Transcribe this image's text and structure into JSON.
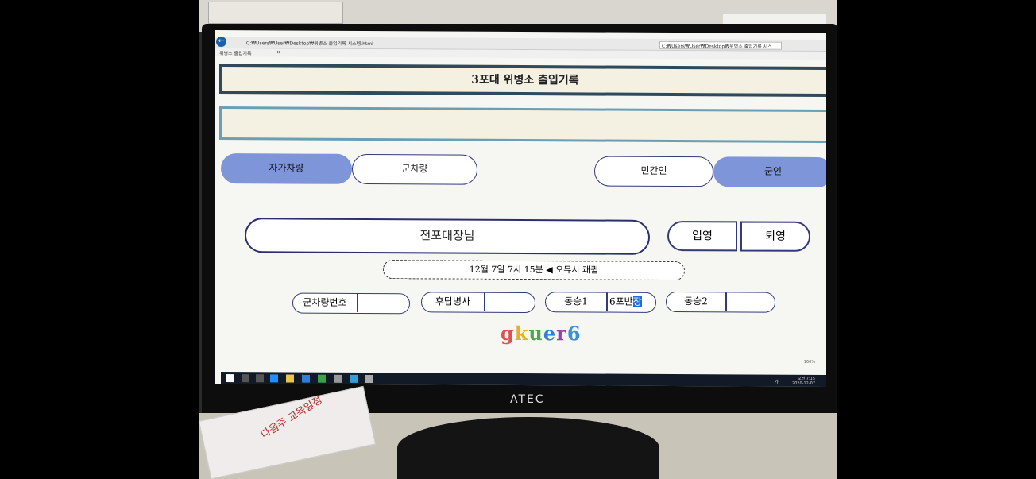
{
  "browser": {
    "back_icon": "back-arrow-icon",
    "address": "C:₩Users₩User₩Desktop₩위병소 출입기록 시스템.html",
    "address_right": "C:₩Users₩User₩Desktop₩위병소 출입기록 시스템.html",
    "tab_label": "위병소 출입기록",
    "tab_close": "×"
  },
  "app": {
    "title": "3포대 위병소 출입기록",
    "vehicle_tabs": {
      "private": "자가차량",
      "military": "군차량"
    },
    "person_tabs": {
      "civilian": "민간인",
      "soldier": "군인"
    },
    "name_value": "전포대장님",
    "enter_label": "입영",
    "exit_label": "퇴영",
    "time_text": "12월 7일 7시 15분 ◀ 오뮤시 쾌큄",
    "fields": {
      "vehicle_no_label": "군차량번호",
      "vehicle_no_value": "",
      "rear_seat_label": "후탑병사",
      "rear_seat_value": "",
      "companion1_label": "동승1",
      "companion1_value": "6포반",
      "companion1_selected": "장",
      "companion2_label": "동승2",
      "companion2_value": ""
    },
    "footer_text": [
      "g",
      "k",
      "u",
      "e",
      "r",
      "6"
    ],
    "footer_colors": [
      "#d9534f",
      "#e0b42a",
      "#4aa84a",
      "#2f7fd8",
      "#8e44ad",
      "#3f8fd8"
    ],
    "zoom": "100%"
  },
  "taskbar": {
    "clock_time": "오전 7:15",
    "clock_date": "2020-12-07",
    "ime": "가"
  },
  "monitor": {
    "brand": "ATEC"
  },
  "photo_extras": {
    "paper_text": "다음주 교육일정"
  }
}
